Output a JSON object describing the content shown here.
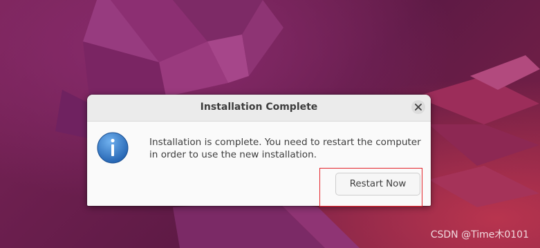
{
  "dialog": {
    "title": "Installation Complete",
    "message_line1": "Installation is complete. You need to restart the computer",
    "message_line2": "in order to use the new installation.",
    "restart_button_label": "Restart Now",
    "icon": "info-icon",
    "close_icon": "close-icon"
  },
  "watermark": {
    "text": "CSDN @Time木0101"
  },
  "colors": {
    "wallpaper": "#6a1f4e",
    "dialog_bg": "#fafafa",
    "titlebar_bg": "#ebebeb",
    "info_icon_blue": "#2f7bd1",
    "highlight_red": "#e3242b"
  }
}
